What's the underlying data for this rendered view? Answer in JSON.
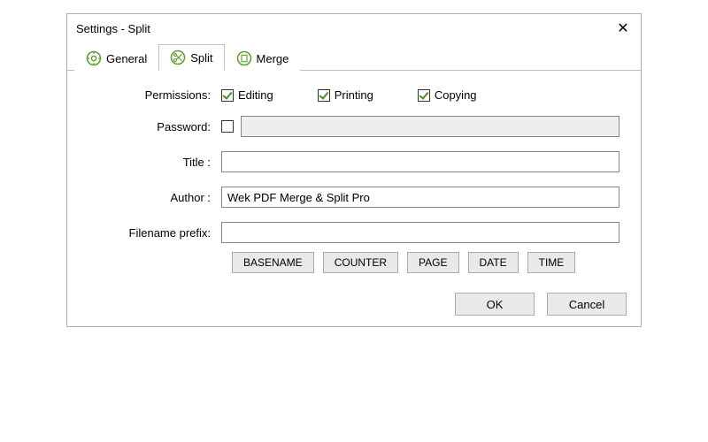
{
  "dialog": {
    "title": "Settings - Split"
  },
  "tabs": {
    "general": {
      "label": "General"
    },
    "split": {
      "label": "Split"
    },
    "merge": {
      "label": "Merge"
    }
  },
  "labels": {
    "permissions": "Permissions:",
    "password": "Password:",
    "title": "Title :",
    "author": "Author :",
    "filename_prefix": "Filename prefix:"
  },
  "permissions": {
    "editing": {
      "label": "Editing",
      "checked": true
    },
    "printing": {
      "label": "Printing",
      "checked": true
    },
    "copying": {
      "label": "Copying",
      "checked": true
    }
  },
  "password": {
    "enabled": false,
    "value": ""
  },
  "fields": {
    "title": "",
    "author": "Wek PDF Merge & Split Pro",
    "filename_prefix": ""
  },
  "filename_buttons": {
    "basename": "BASENAME",
    "counter": "COUNTER",
    "page": "PAGE",
    "date": "DATE",
    "time": "TIME"
  },
  "footer": {
    "ok": "OK",
    "cancel": "Cancel"
  },
  "colors": {
    "accent_green": "#5aa02c"
  }
}
